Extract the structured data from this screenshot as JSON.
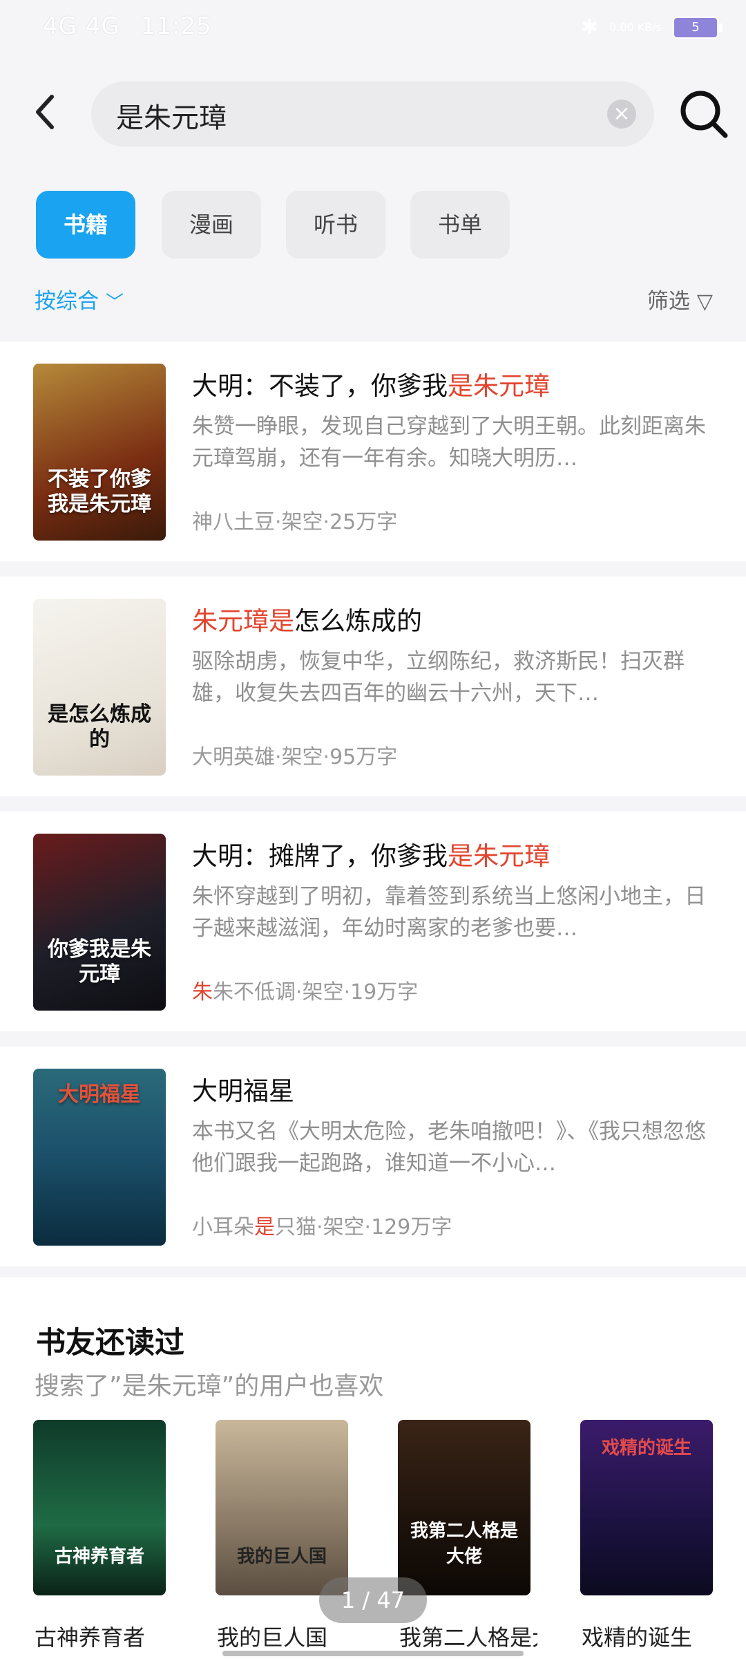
{
  "status_bar": {
    "time": "11:25",
    "network": "4G 4G",
    "speed": "0.00 KB/s",
    "battery": "5"
  },
  "search": {
    "query": "是朱元璋"
  },
  "tabs": [
    {
      "label": "书籍"
    },
    {
      "label": "漫画"
    },
    {
      "label": "听书"
    },
    {
      "label": "书单"
    }
  ],
  "sort": {
    "label": "按综合"
  },
  "filter": {
    "label": "筛选"
  },
  "books": [
    {
      "title_pre": "大明：不装了，你爹我",
      "title_hl": "是朱元璋",
      "title_post": "",
      "cover_text": "不装了你爹我是朱元璋",
      "desc": "朱赞一睁眼，发现自己穿越到了大明王朝。此刻距离朱元璋驾崩，还有一年有余。知晓大明历…",
      "meta_hl": "",
      "meta": "神八土豆·架空·25万字"
    },
    {
      "title_pre": "",
      "title_hl": "朱元璋是",
      "title_post": "怎么炼成的",
      "cover_text": "是怎么炼成的",
      "desc": "驱除胡虏，恢复中华，立纲陈纪，救济斯民！扫灭群雄，收复失去四百年的幽云十六州，天下…",
      "meta_hl": "",
      "meta": "大明英雄·架空·95万字"
    },
    {
      "title_pre": "大明：摊牌了，你爹我",
      "title_hl": "是朱元璋",
      "title_post": "",
      "cover_text": "你爹我是朱元璋",
      "desc": "朱怀穿越到了明初，靠着签到系统当上悠闲小地主，日子越来越滋润，年幼时离家的老爹也要…",
      "meta_hl": "朱",
      "meta": "朱不低调·架空·19万字"
    },
    {
      "title_pre": "大明福星",
      "title_hl": "",
      "title_post": "",
      "cover_text": "大明福星",
      "desc": "本书又名《大明太危险，老朱咱撤吧！》、《我只想忽悠他们跟我一起跑路，谁知道一不小心…",
      "meta_hl": "",
      "meta_pre": "小耳朵",
      "meta_mid_hl": "是",
      "meta_post": "只猫·架空·129万字"
    }
  ],
  "recommend": {
    "title": "书友还读过",
    "subtitle": "搜索了”是朱元璋”的用户也喜欢",
    "items": [
      {
        "name": "古神养育者",
        "cover": "古神养育者"
      },
      {
        "name": "我的巨人国",
        "cover": "我的巨人国"
      },
      {
        "name": "我第二人格是大佬",
        "cover": "我第二人格是大佬"
      },
      {
        "name": "戏精的诞生",
        "cover": "戏精的诞生"
      }
    ]
  },
  "pager": "1 / 47"
}
